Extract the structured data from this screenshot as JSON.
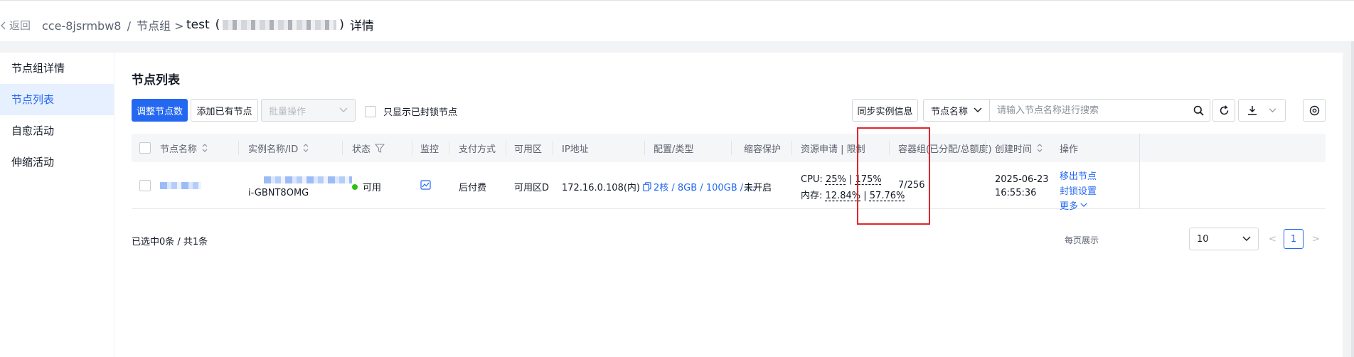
{
  "header": {
    "back_label": "返回",
    "breadcrumb_cluster": "cce-8jsrmbw8",
    "breadcrumb_sep": "/",
    "breadcrumb_group": "节点组",
    "breadcrumb_arrow": ">",
    "title_prefix": "test",
    "title_open": "(",
    "title_close": ")",
    "title_suffix": "详情"
  },
  "sidebar": {
    "items": [
      {
        "label": "节点组详情",
        "active": false
      },
      {
        "label": "节点列表",
        "active": true
      },
      {
        "label": "自愈活动",
        "active": false
      },
      {
        "label": "伸缩活动",
        "active": false
      }
    ]
  },
  "main": {
    "section_title": "节点列表",
    "toolbar": {
      "adjust_label": "调整节点数",
      "add_existing_label": "添加已有节点",
      "batch_label": "批量操作",
      "only_locked_label": "只显示已封锁节点",
      "sync_label": "同步实例信息",
      "search_field_label": "节点名称",
      "search_placeholder": "请输入节点名称进行搜索"
    },
    "columns": {
      "name": "节点名称",
      "instance": "实例名称/ID",
      "status": "状态",
      "monitor": "监控",
      "payment": "支付方式",
      "zone": "可用区",
      "ip": "IP地址",
      "config": "配置/类型",
      "scale_protect": "缩容保护",
      "resources": "资源申请 | 限制",
      "pods": "容器组(已分配/总额度)",
      "created": "创建时间",
      "ops": "操作"
    },
    "row": {
      "instance_id": "i-GBNT8OMG",
      "status": "可用",
      "payment": "后付费",
      "zone": "可用区D",
      "ip": "172.16.0.108(内)",
      "config": "2核 / 8GB / 100GB / ...",
      "scale_protect": "未开启",
      "cpu_label": "CPU:",
      "cpu_request": "25%",
      "cpu_limit": "175%",
      "mem_label": "内存:",
      "mem_request": "12.84%",
      "mem_limit": "57.76%",
      "sep": "|",
      "pods": "7/256",
      "created_date": "2025-06-23",
      "created_time": "16:55:36",
      "op_remove": "移出节点",
      "op_lock": "封锁设置",
      "op_more": "更多"
    },
    "footer": {
      "selected_text": "已选中0条 / 共1条",
      "per_page_label": "每页展示",
      "per_page_value": "10",
      "prev": "<",
      "current_page": "1",
      "next": ">"
    }
  },
  "colors": {
    "primary": "#2468f2",
    "status_ok": "#30bf13",
    "highlight_box": "#e0252f"
  }
}
